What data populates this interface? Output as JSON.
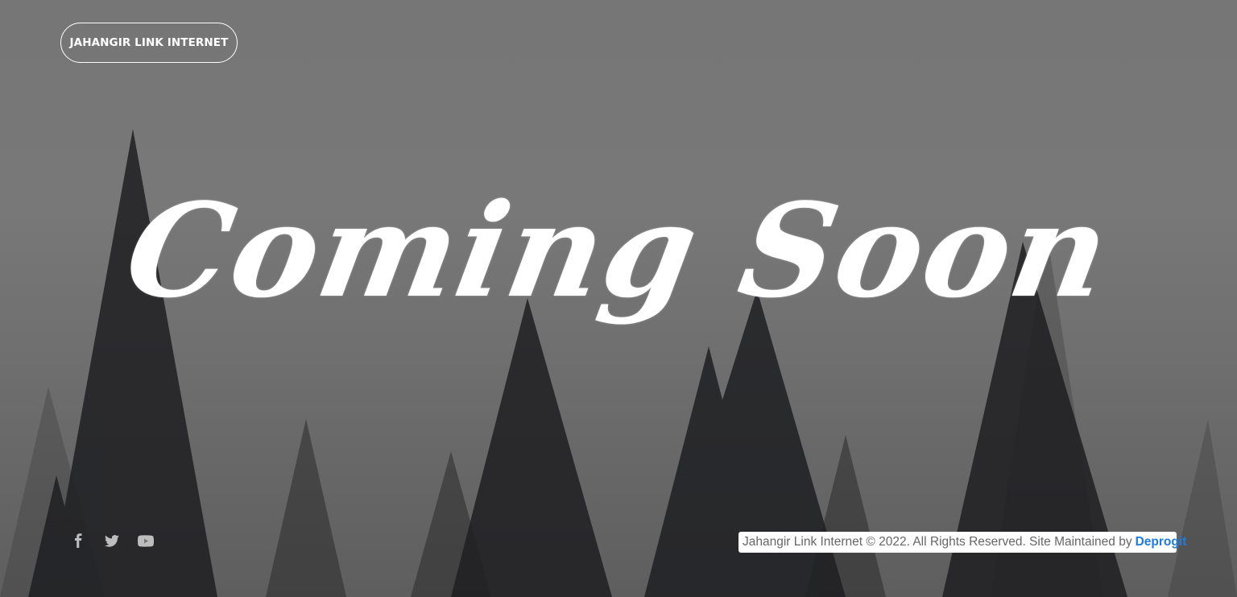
{
  "brand": {
    "label": "JAHANGIR LINK INTERNET"
  },
  "hero": {
    "title": "Coming Soon"
  },
  "social": [
    {
      "icon": "facebook-icon"
    },
    {
      "icon": "twitter-icon"
    },
    {
      "icon": "youtube-icon"
    }
  ],
  "footer": {
    "text": "Jahangir Link Internet © 2022. All Rights Reserved. Site Maintained by",
    "link_label": "Deprogit",
    "link_color": "#1f7bdc"
  },
  "colors": {
    "overlay": "#777777",
    "text": "#ffffff"
  }
}
